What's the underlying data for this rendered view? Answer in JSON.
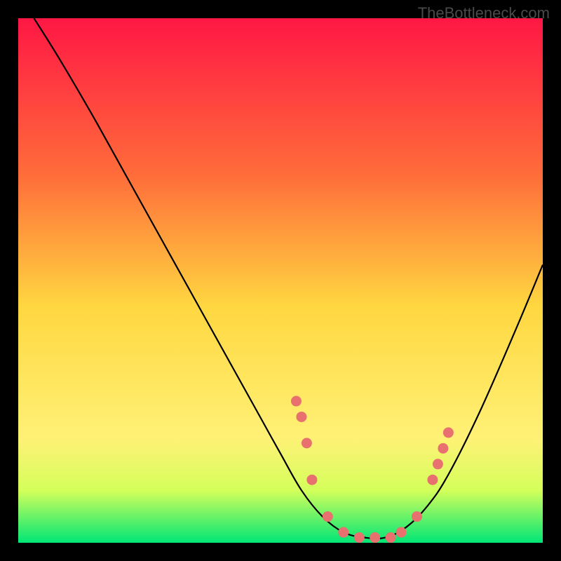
{
  "watermark": "TheBottleneck.com",
  "chart_data": {
    "type": "line",
    "title": "",
    "xlabel": "",
    "ylabel": "",
    "xlim": [
      0,
      100
    ],
    "ylim": [
      0,
      100
    ],
    "gradient_stops": [
      {
        "offset": 0,
        "color": "#ff1744"
      },
      {
        "offset": 30,
        "color": "#ff6d3a"
      },
      {
        "offset": 55,
        "color": "#ffd740"
      },
      {
        "offset": 80,
        "color": "#fff176"
      },
      {
        "offset": 90,
        "color": "#d4ff5a"
      },
      {
        "offset": 100,
        "color": "#00e676"
      }
    ],
    "curve": [
      {
        "x": 3,
        "y": 100
      },
      {
        "x": 8,
        "y": 92
      },
      {
        "x": 15,
        "y": 80
      },
      {
        "x": 25,
        "y": 62
      },
      {
        "x": 35,
        "y": 44
      },
      {
        "x": 45,
        "y": 26
      },
      {
        "x": 50,
        "y": 17
      },
      {
        "x": 54,
        "y": 10
      },
      {
        "x": 58,
        "y": 5
      },
      {
        "x": 62,
        "y": 2
      },
      {
        "x": 66,
        "y": 1
      },
      {
        "x": 70,
        "y": 1
      },
      {
        "x": 74,
        "y": 3
      },
      {
        "x": 78,
        "y": 7
      },
      {
        "x": 82,
        "y": 13
      },
      {
        "x": 88,
        "y": 25
      },
      {
        "x": 95,
        "y": 41
      },
      {
        "x": 100,
        "y": 53
      }
    ],
    "markers": [
      {
        "x": 53,
        "y": 27
      },
      {
        "x": 54,
        "y": 24
      },
      {
        "x": 55,
        "y": 19
      },
      {
        "x": 56,
        "y": 12
      },
      {
        "x": 59,
        "y": 5
      },
      {
        "x": 62,
        "y": 2
      },
      {
        "x": 65,
        "y": 1
      },
      {
        "x": 68,
        "y": 1
      },
      {
        "x": 71,
        "y": 1
      },
      {
        "x": 73,
        "y": 2
      },
      {
        "x": 76,
        "y": 5
      },
      {
        "x": 79,
        "y": 12
      },
      {
        "x": 80,
        "y": 15
      },
      {
        "x": 81,
        "y": 18
      },
      {
        "x": 82,
        "y": 21
      }
    ],
    "marker_color": "#e8716f",
    "curve_color": "#000000"
  }
}
